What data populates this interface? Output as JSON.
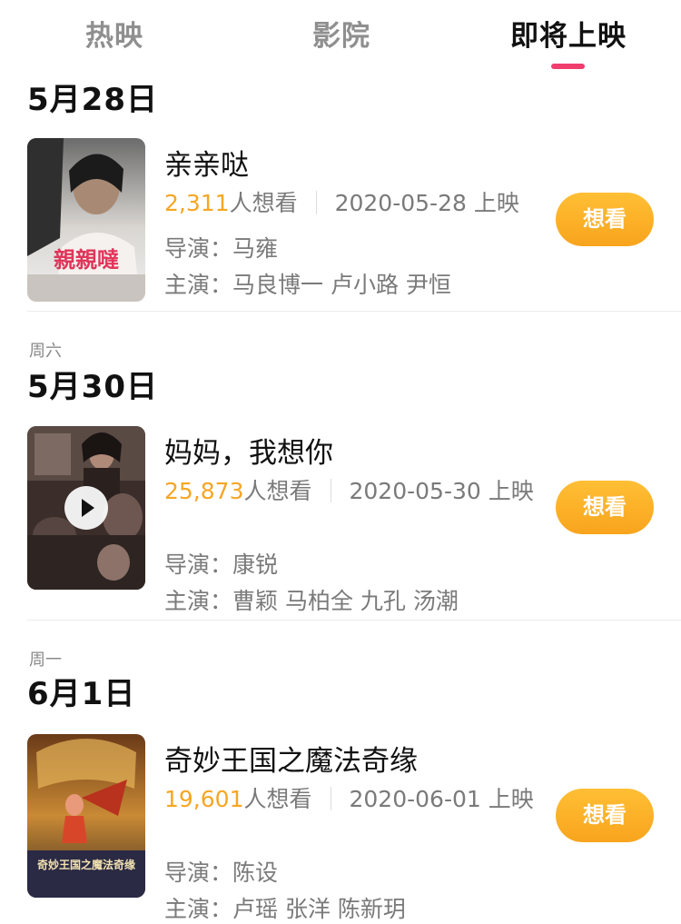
{
  "tabs": [
    {
      "label": "热映"
    },
    {
      "label": "影院"
    },
    {
      "label": "即将上映",
      "active": true
    }
  ],
  "accent_colors": {
    "tab_indicator": "#f03d6e",
    "want_count": "#f6a623",
    "button": "#f8a41d"
  },
  "sections": [
    {
      "weekday": "",
      "date": "5月28日",
      "movies": [
        {
          "title": "亲亲哒",
          "want_count": "2,311",
          "want_label": "人想看",
          "release": "2020-05-28 上映",
          "director_label": "导演：",
          "director": "马雍",
          "cast_label": "主演：",
          "cast": "马良博一 卢小路 尹恒",
          "button": "想看",
          "poster_text": "親親噠"
        }
      ]
    },
    {
      "weekday": "周六",
      "date": "5月30日",
      "movies": [
        {
          "title": "妈妈，我想你",
          "want_count": "25,873",
          "want_label": "人想看",
          "release": "2020-05-30 上映",
          "director_label": "导演：",
          "director": "康锐",
          "cast_label": "主演：",
          "cast": "曹颖 马柏全 九孔 汤潮",
          "button": "想看",
          "has_video": true
        }
      ]
    },
    {
      "weekday": "周一",
      "date": "6月1日",
      "movies": [
        {
          "title": "奇妙王国之魔法奇缘",
          "want_count": "19,601",
          "want_label": "人想看",
          "release": "2020-06-01 上映",
          "director_label": "导演：",
          "director": "陈设",
          "cast_label": "主演：",
          "cast": "卢瑶 张洋 陈新玥",
          "button": "想看",
          "poster_text": "奇妙王国之魔法奇缘"
        }
      ]
    }
  ]
}
